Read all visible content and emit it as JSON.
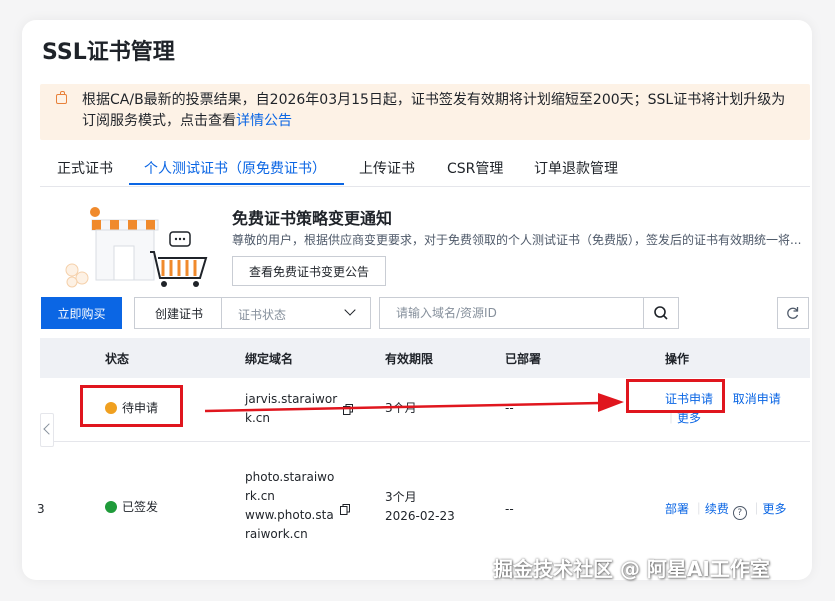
{
  "page": {
    "title": "SSL证书管理"
  },
  "notice": {
    "text": "根据CA/B最新的投票结果，自2026年03月15日起，证书签发有效期将计划缩短至200天；SSL证书将计划升级为订阅服务模式，点击查看",
    "link": "详情公告"
  },
  "tabs": [
    "正式证书",
    "个人测试证书（原免费证书）",
    "上传证书",
    "CSR管理",
    "订单退款管理"
  ],
  "tabs_active": "个人测试证书（原免费证书）",
  "promo": {
    "title": "免费证书策略变更通知",
    "desc": "尊敬的用户，根据供应商变更要求，对于免费领取的个人测试证书（免费版），签发后的证书有效期统一将...",
    "button": "查看免费证书变更公告"
  },
  "toolbar": {
    "buy": "立即购买",
    "create": "创建证书",
    "status_select": "证书状态",
    "search_placeholder": "请输入域名/资源ID"
  },
  "table": {
    "headers": {
      "status": "状态",
      "domain": "绑定域名",
      "validity": "有效期限",
      "deployed": "已部署",
      "actions": "操作"
    },
    "rows": [
      {
        "status": "待申请",
        "domain": [
          "jarvis.staraiwor",
          "k.cn"
        ],
        "validity": "3个月",
        "deployed": "--",
        "actions": {
          "apply": "证书申请",
          "cancel": "取消申请",
          "more": "更多"
        }
      },
      {
        "id_fragment": "3",
        "status": "已签发",
        "domain": [
          "photo.staraiwo",
          "rk.cn",
          "www.photo.sta",
          "raiwork.cn"
        ],
        "validity": "3个月",
        "expiry": "2026-02-23",
        "deployed": "--",
        "actions": {
          "deploy": "部署",
          "renew": "续费",
          "more": "更多"
        }
      }
    ]
  },
  "watermark": "掘金技术社区 @ 阿星AI工作室",
  "colors": {
    "primary": "#0b66e4",
    "annotation_red": "#e0161e",
    "notice_bg": "#fdf2e6",
    "warn": "#f0a020",
    "success": "#1f9b3a"
  }
}
